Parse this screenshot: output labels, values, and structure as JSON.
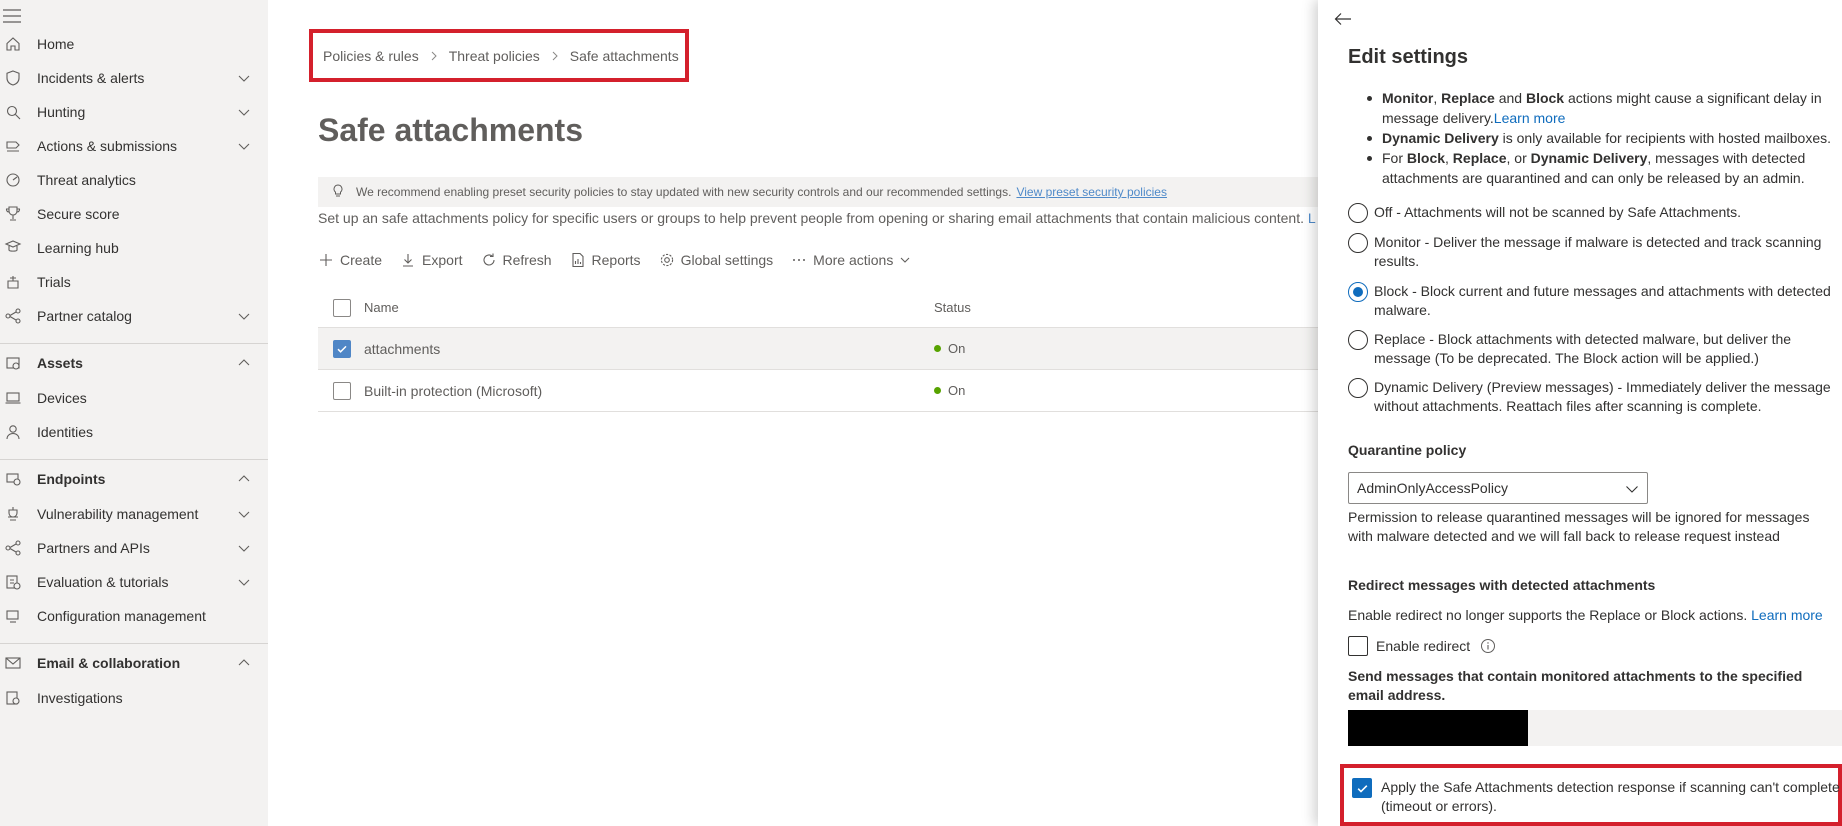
{
  "sidebar": {
    "items": [
      {
        "label": "Home",
        "icon": "home-icon",
        "chevron": false,
        "section": false
      },
      {
        "label": "Incidents & alerts",
        "icon": "shield-icon",
        "chevron": "down",
        "section": false
      },
      {
        "label": "Hunting",
        "icon": "hunting-icon",
        "chevron": "down",
        "section": false
      },
      {
        "label": "Actions & submissions",
        "icon": "actions-icon",
        "chevron": "down",
        "section": false
      },
      {
        "label": "Threat analytics",
        "icon": "threat-analytics-icon",
        "chevron": false,
        "section": false
      },
      {
        "label": "Secure score",
        "icon": "trophy-icon",
        "chevron": false,
        "section": false
      },
      {
        "label": "Learning hub",
        "icon": "learning-hub-icon",
        "chevron": false,
        "section": false
      },
      {
        "label": "Trials",
        "icon": "trials-icon",
        "chevron": false,
        "section": false
      },
      {
        "label": "Partner catalog",
        "icon": "partner-catalog-icon",
        "chevron": "down",
        "section": false
      },
      {
        "label": "Assets",
        "icon": "assets-icon",
        "chevron": "up",
        "section": true
      },
      {
        "label": "Devices",
        "icon": "devices-icon",
        "chevron": false,
        "section": false
      },
      {
        "label": "Identities",
        "icon": "person-icon",
        "chevron": false,
        "section": false
      },
      {
        "label": "Endpoints",
        "icon": "endpoints-icon",
        "chevron": "up",
        "section": true
      },
      {
        "label": "Vulnerability management",
        "icon": "vulnerability-icon",
        "chevron": "down",
        "section": false
      },
      {
        "label": "Partners and APIs",
        "icon": "partners-apis-icon",
        "chevron": "down",
        "section": false
      },
      {
        "label": "Evaluation & tutorials",
        "icon": "evaluation-icon",
        "chevron": "down",
        "section": false
      },
      {
        "label": "Configuration management",
        "icon": "configuration-icon",
        "chevron": false,
        "section": false
      },
      {
        "label": "Email & collaboration",
        "icon": "mail-icon",
        "chevron": "up",
        "section": true
      },
      {
        "label": "Investigations",
        "icon": "investigations-icon",
        "chevron": false,
        "section": false
      }
    ]
  },
  "breadcrumb": [
    "Policies & rules",
    "Threat policies",
    "Safe attachments"
  ],
  "page": {
    "title": "Safe attachments",
    "recommendation": "We recommend enabling preset security policies to stay updated with new security controls and our recommended settings.",
    "recommendation_link": "View preset security policies",
    "description": "Set up an safe attachments policy for specific users or groups to help prevent people from opening or sharing email attachments that contain malicious content.",
    "description_link": "L"
  },
  "toolbar": {
    "create": "Create",
    "export": "Export",
    "refresh": "Refresh",
    "reports": "Reports",
    "global_settings": "Global settings",
    "more_actions": "More actions"
  },
  "table": {
    "columns": [
      "Name",
      "Status"
    ],
    "rows": [
      {
        "name": "attachments",
        "status": "On",
        "checked": true
      },
      {
        "name": "Built-in protection (Microsoft)",
        "status": "On",
        "checked": false
      }
    ]
  },
  "panel": {
    "title": "Edit settings",
    "bullets": [
      {
        "b1": "Monitor",
        "t1": ", ",
        "b2": "Replace",
        "t2": " and ",
        "b3": "Block",
        "t3": " actions might cause a significant delay in message delivery.",
        "link": "Learn more"
      },
      {
        "b1": "Dynamic Delivery",
        "t1": " is only available for recipients with hosted mailboxes."
      },
      {
        "t0": "For ",
        "b1": "Block",
        "t1": ", ",
        "b2": "Replace",
        "t2": ", or ",
        "b3": "Dynamic Delivery",
        "t3": ", messages with detected attachments are quarantined and can only be released by an admin."
      }
    ],
    "radios": [
      {
        "label": "Off - Attachments will not be scanned by Safe Attachments.",
        "selected": false
      },
      {
        "label": "Monitor - Deliver the message if malware is detected and track scanning results.",
        "selected": false
      },
      {
        "label": "Block - Block current and future messages and attachments with detected malware.",
        "selected": true
      },
      {
        "label": "Replace - Block attachments with detected malware, but deliver the message (To be deprecated. The Block action will be applied.)",
        "selected": false
      },
      {
        "label": "Dynamic Delivery (Preview messages) - Immediately deliver the message without attachments. Reattach files after scanning is complete.",
        "selected": false
      }
    ],
    "quarantine_label": "Quarantine policy",
    "quarantine_value": "AdminOnlyAccessPolicy",
    "quarantine_help": "Permission to release quarantined messages will be ignored for messages with malware detected and we will fall back to release request instead",
    "redirect_label": "Redirect messages with detected attachments",
    "redirect_help": "Enable redirect no longer supports the Replace or Block actions.",
    "redirect_help_link": "Learn more",
    "enable_redirect": "Enable redirect",
    "send_label": "Send messages that contain monitored attachments to the specified email address.",
    "apply_label": "Apply the Safe Attachments detection response if scanning can't complete (timeout or errors).",
    "apply_checked": true
  },
  "colors": {
    "highlight_border": "#d4202c",
    "accent": "#0f6cbd",
    "status_on": "#57a300",
    "sidebar_bg": "#f3f2f1"
  }
}
